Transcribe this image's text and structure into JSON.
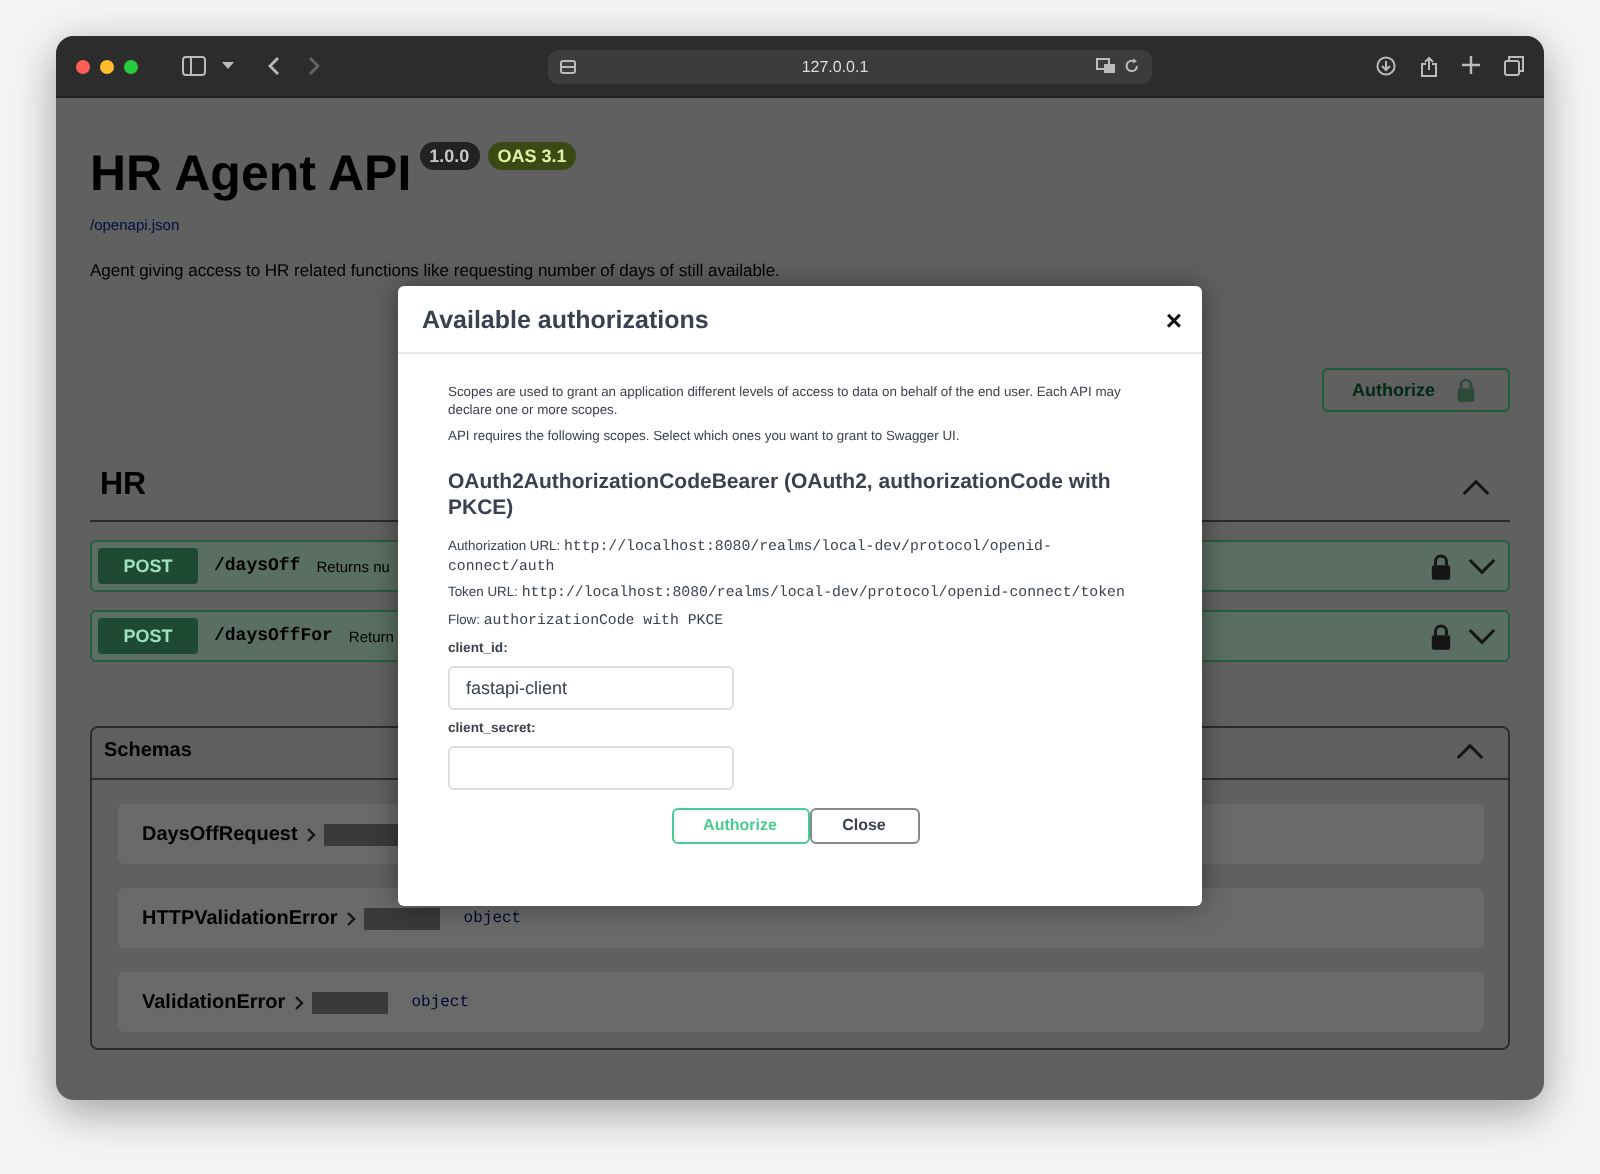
{
  "browser": {
    "address": "127.0.0.1"
  },
  "page": {
    "title": "HR Agent API",
    "version_badge": "1.0.0",
    "oas_badge": "OAS 3.1",
    "spec_link": "/openapi.json",
    "description": "Agent giving access to HR related functions like requesting number of days of still available.",
    "authorize_button": "Authorize"
  },
  "sections": [
    {
      "name": "HR",
      "expanded": true,
      "operations": [
        {
          "method": "POST",
          "path": "/daysOff",
          "summary": "Returns nu",
          "locked": true,
          "expanded": false
        },
        {
          "method": "POST",
          "path": "/daysOffFor",
          "summary": "Return",
          "locked": true,
          "expanded": false
        }
      ]
    }
  ],
  "schemas": {
    "title": "Schemas",
    "expanded": true,
    "items": [
      {
        "name": "DaysOffRequest"
      },
      {
        "name": "HTTPValidationError",
        "type": "object"
      },
      {
        "name": "ValidationError",
        "type": "object"
      }
    ]
  },
  "modal": {
    "title": "Available authorizations",
    "close": "×",
    "intro": [
      "Scopes are used to grant an application different levels of access to data on behalf of the end user. Each API may declare one or more scopes.",
      "API requires the following scopes. Select which ones you want to grant to Swagger UI."
    ],
    "scheme_title": "OAuth2AuthorizationCodeBearer (OAuth2, authorizationCode with PKCE)",
    "details": [
      {
        "label": "Authorization URL:",
        "value": "http://localhost:8080/realms/local-dev/protocol/openid-connect/auth"
      },
      {
        "label": "Token URL:",
        "value": "http://localhost:8080/realms/local-dev/protocol/openid-connect/token"
      },
      {
        "label": "Flow:",
        "value": "authorizationCode with PKCE"
      }
    ],
    "fields": [
      {
        "label": "client_id:",
        "value": "fastapi-client"
      },
      {
        "label": "client_secret:"
      }
    ],
    "buttons": [
      {
        "label": "Authorize",
        "kind": "primary"
      },
      {
        "label": "Close",
        "kind": "secondary"
      }
    ]
  }
}
